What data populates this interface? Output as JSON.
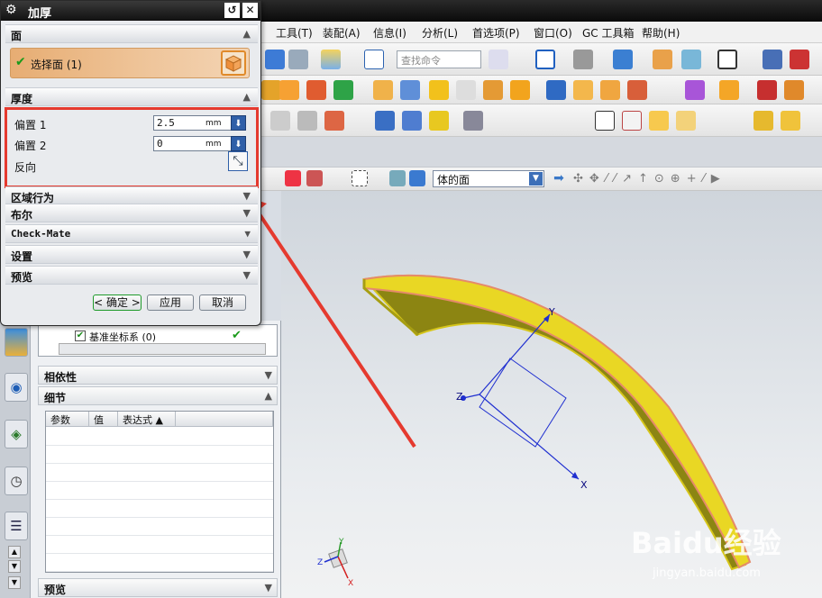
{
  "dialog": {
    "title": "加厚",
    "sections": {
      "face": "面",
      "thickness": "厚度",
      "region": "区域行为",
      "boolean": "布尔",
      "checkmate": "Check-Mate",
      "settings": "设置",
      "preview": "预览"
    },
    "select_face_label": "选择面 (1)",
    "offset1_label": "偏置 1",
    "offset1_value": "2.5",
    "offset2_label": "偏置 2",
    "offset2_value": "0",
    "unit": "mm",
    "reverse_label": "反向",
    "buttons": {
      "ok": "< 确定 >",
      "apply": "应用",
      "cancel": "取消"
    }
  },
  "menu": [
    "工具(T)",
    "装配(A)",
    "信息(I)",
    "分析(L)",
    "首选项(P)",
    "窗口(O)",
    "GC 工具箱",
    "帮助(H)"
  ],
  "toolbar": {
    "search_placeholder": "查找命令"
  },
  "selection_bar": {
    "filter_value": "体的面"
  },
  "navigator": {
    "tree_item": "基准坐标系 (0)",
    "dependencies": "相依性",
    "details": "细节",
    "columns": [
      "参数",
      "值",
      "表达式 ▲"
    ],
    "preview": "预览"
  },
  "viewport": {
    "axis_labels": {
      "x": "X",
      "y": "Y",
      "z": "Z"
    },
    "watermark_brand": "Baidu经验",
    "watermark_url": "jingyan.baidu.com"
  },
  "colors": {
    "accent": "#e53a2f",
    "body": "#e8d21a",
    "edge": "#e58a6a"
  }
}
